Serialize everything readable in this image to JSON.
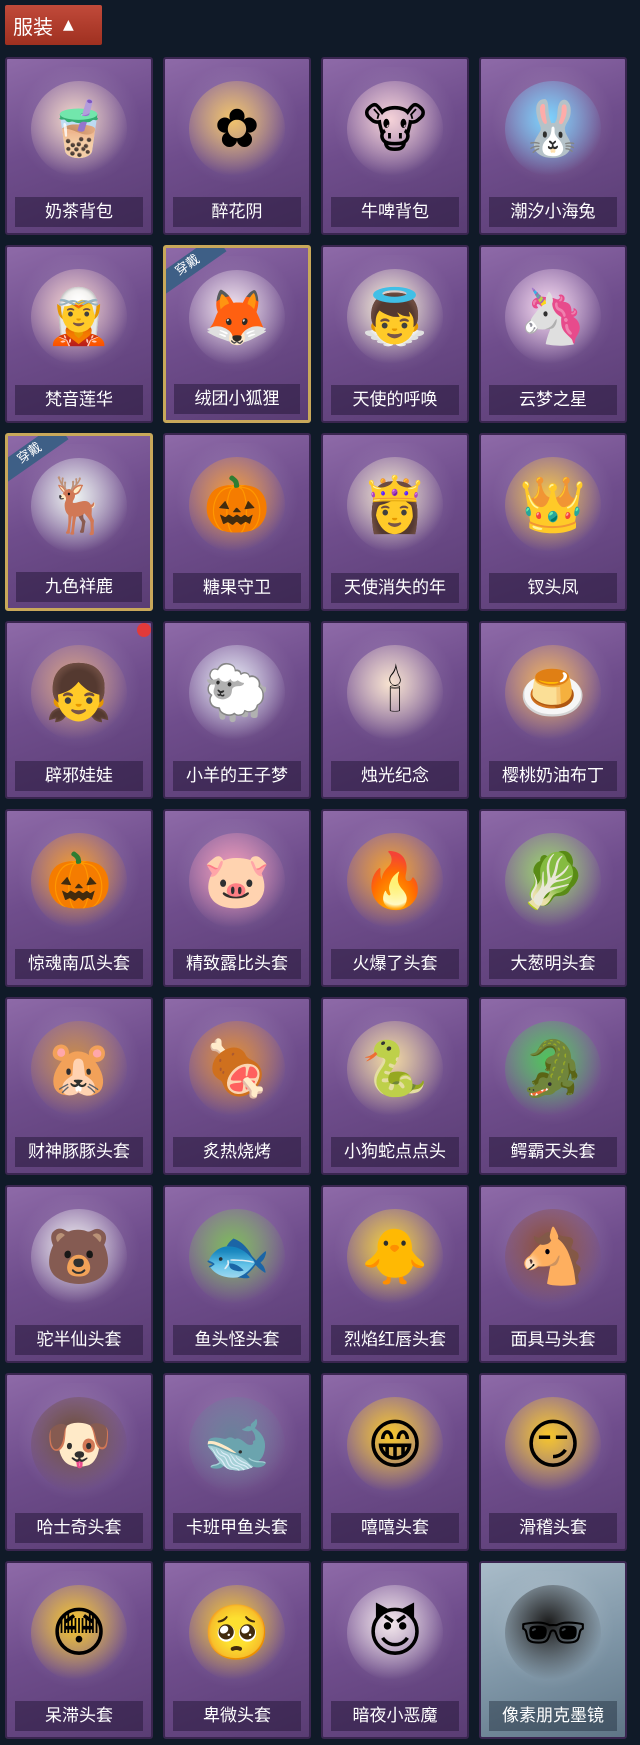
{
  "header": {
    "label": "服装",
    "icon": "chevron-up-icon"
  },
  "equipped_badge": "穿戴",
  "items": [
    {
      "name": "奶茶背包",
      "glyph": "🧋",
      "color": "#f2d6c8"
    },
    {
      "name": "醉花阴",
      "glyph": "✿",
      "color": "#f2c46a"
    },
    {
      "name": "牛啤背包",
      "glyph": "🐮",
      "color": "#f5d2d8"
    },
    {
      "name": "潮汐小海兔",
      "glyph": "🐰",
      "color": "#7bd4ff"
    },
    {
      "name": "梵音莲华",
      "glyph": "🧝",
      "color": "#f6d3cf"
    },
    {
      "name": "绒团小狐狸",
      "glyph": "🦊",
      "color": "#f3e5ef",
      "equipped": true
    },
    {
      "name": "天使的呼唤",
      "glyph": "👼",
      "color": "#fbf3d8"
    },
    {
      "name": "云梦之星",
      "glyph": "🦄",
      "color": "#f6d8f0"
    },
    {
      "name": "九色祥鹿",
      "glyph": "🦌",
      "color": "#eef4f2",
      "equipped": true
    },
    {
      "name": "糖果守卫",
      "glyph": "🎃",
      "color": "#f29a3a"
    },
    {
      "name": "天使消失的年",
      "glyph": "👸",
      "color": "#f2e6cf"
    },
    {
      "name": "钗头凤",
      "glyph": "👑",
      "color": "#f3c24a"
    },
    {
      "name": "辟邪娃娃",
      "glyph": "👧",
      "color": "#d8a080",
      "dot": true
    },
    {
      "name": "小羊的王子梦",
      "glyph": "🐑",
      "color": "#e8ecf7"
    },
    {
      "name": "烛光纪念",
      "glyph": "🕯",
      "color": "#f8e3d0"
    },
    {
      "name": "樱桃奶油布丁",
      "glyph": "🍮",
      "color": "#f2b25a"
    },
    {
      "name": "惊魂南瓜头套",
      "glyph": "🎃",
      "color": "#f59a2a"
    },
    {
      "name": "精致露比头套",
      "glyph": "🐷",
      "color": "#f39ab8"
    },
    {
      "name": "火爆了头套",
      "glyph": "🔥",
      "color": "#f6a02a"
    },
    {
      "name": "大葱明头套",
      "glyph": "🥬",
      "color": "#9ad46a"
    },
    {
      "name": "财神豚豚头套",
      "glyph": "🐹",
      "color": "#c98a48"
    },
    {
      "name": "炙热烧烤",
      "glyph": "🍖",
      "color": "#e08a32"
    },
    {
      "name": "小狗蛇点点头",
      "glyph": "🐍",
      "color": "#f2d9a0"
    },
    {
      "name": "鳄霸天头套",
      "glyph": "🐊",
      "color": "#4fc35a"
    },
    {
      "name": "驼半仙头套",
      "glyph": "🐻",
      "color": "#f2f2f2"
    },
    {
      "name": "鱼头怪头套",
      "glyph": "🐟",
      "color": "#7dba5a"
    },
    {
      "name": "烈焰红唇头套",
      "glyph": "🐥",
      "color": "#f4cf3a"
    },
    {
      "name": "面具马头套",
      "glyph": "🐴",
      "color": "#8a4a32"
    },
    {
      "name": "哈士奇头套",
      "glyph": "🐶",
      "color": "#6a4a32"
    },
    {
      "name": "卡班甲鱼头套",
      "glyph": "🐋",
      "color": "#6a7f9a"
    },
    {
      "name": "嘻嘻头套",
      "glyph": "😁",
      "color": "#f7c62a"
    },
    {
      "name": "滑稽头套",
      "glyph": "😏",
      "color": "#f7c62a"
    },
    {
      "name": "呆滞头套",
      "glyph": "😳",
      "color": "#f7c62a"
    },
    {
      "name": "卑微头套",
      "glyph": "🥺",
      "color": "#f7c62a"
    },
    {
      "name": "暗夜小恶魔",
      "glyph": "😈",
      "color": "#f4e8ec"
    },
    {
      "name": "像素朋克墨镜",
      "glyph": "🕶",
      "color": "#1a1a1a",
      "special": true
    }
  ]
}
